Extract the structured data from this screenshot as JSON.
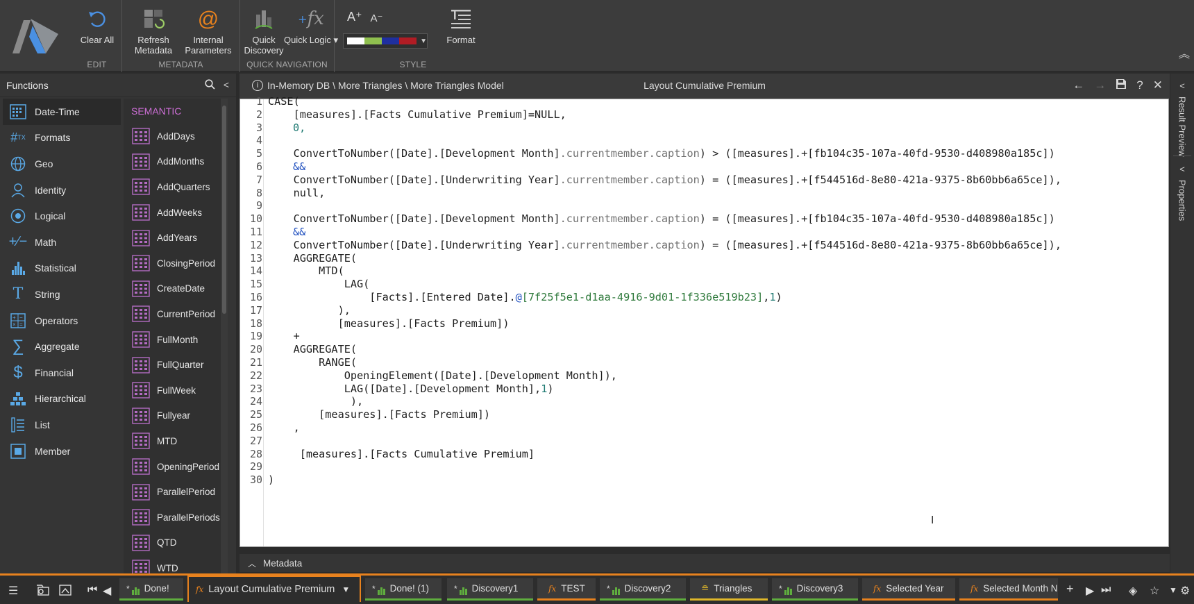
{
  "ribbon": {
    "groups": [
      {
        "label": "EDIT",
        "buttons": [
          {
            "label": "Clear All",
            "icon": "undo-icon"
          }
        ]
      },
      {
        "label": "METADATA",
        "buttons": [
          {
            "label": "Refresh Metadata",
            "icon": "refresh-metadata-icon"
          },
          {
            "label": "Internal Parameters",
            "icon": "at-sign-icon"
          }
        ]
      },
      {
        "label": "QUICK NAVIGATION",
        "buttons": [
          {
            "label": "Quick Discovery",
            "icon": "bar-chart-icon"
          },
          {
            "label": "Quick Logic ▾",
            "icon": "fx-icon"
          }
        ]
      },
      {
        "label": "STYLE",
        "buttons": [
          {
            "label": "Format",
            "icon": "format-icon"
          }
        ]
      }
    ],
    "font_size_icons": [
      "A⁺",
      "A⁻"
    ],
    "palette_colors": [
      "#ffffff",
      "#8fbf4f",
      "#1f2f9f",
      "#b01c24"
    ]
  },
  "functions_panel": {
    "title": "Functions",
    "categories": [
      "Date-Time",
      "Formats",
      "Geo",
      "Identity",
      "Logical",
      "Math",
      "Statistical",
      "String",
      "Operators",
      "Aggregate",
      "Financial",
      "Hierarchical",
      "List",
      "Member"
    ],
    "active_category": "Date-Time",
    "section_label": "SEMANTIC",
    "functions": [
      "AddDays",
      "AddMonths",
      "AddQuarters",
      "AddWeeks",
      "AddYears",
      "ClosingPeriod",
      "CreateDate",
      "CurrentPeriod",
      "FullMonth",
      "FullQuarter",
      "FullWeek",
      "Fullyear",
      "MTD",
      "OpeningPeriod",
      "ParallelPeriod",
      "ParallelPeriods",
      "QTD",
      "WTD"
    ]
  },
  "editor": {
    "path": "In-Memory DB \\ More Triangles \\ More Triangles Model",
    "title": "Layout Cumulative Premium",
    "line_numbers": [
      "1",
      "2",
      "3",
      "4",
      "5",
      "6",
      "7",
      "8",
      "9",
      "10",
      "11",
      "12",
      "13",
      "14",
      "15",
      "16",
      "17",
      "18",
      "19",
      "20",
      "21",
      "22",
      "23",
      "24",
      "25",
      "26",
      "27",
      "28",
      "29",
      "30"
    ],
    "code": {
      "l1": "CASE(",
      "l2": "    [measures].[Facts Cumulative Premium]=NULL,",
      "l3": "0,",
      "l5a": "    ConvertToNumber([Date].[Development Month]",
      "l5b": ".currentmember.caption",
      "l5c": ") > ([measures].+[fb104c35-107a-40fd-9530-d408980a185c])",
      "l6": "&&",
      "l7a": "    ConvertToNumber([Date].[Underwriting Year]",
      "l7b": ".currentmember.caption",
      "l7c": ") = ([measures].+[f544516d-8e80-421a-9375-8b60bb6a65ce]),",
      "l8": "    null,",
      "l10a": "    ConvertToNumber([Date].[Development Month]",
      "l10b": ".currentmember.caption",
      "l10c": ") = ([measures].+[fb104c35-107a-40fd-9530-d408980a185c])",
      "l11": "&&",
      "l12a": "    ConvertToNumber([Date].[Underwriting Year]",
      "l12b": ".currentmember.caption",
      "l12c": ") = ([measures].+[f544516d-8e80-421a-9375-8b60bb6a65ce]),",
      "l13": "    AGGREGATE(",
      "l14": "        MTD(",
      "l15": "            LAG(",
      "l16a": "                [Facts].[Entered Date].",
      "l16b": "@",
      "l16c": "[7f25f5e1-d1aa-4916-9d01-1f336e519b23]",
      "l16d": ",",
      "l16e": "1",
      "l16f": ")",
      "l17": "           ),",
      "l18": "           [measures].[Facts Premium])",
      "l19": "    +",
      "l20": "    AGGREGATE(",
      "l21": "        RANGE(",
      "l22": "            OpeningElement([Date].[Development Month]),",
      "l23a": "            LAG([Date].[Development Month],",
      "l23b": "1",
      "l23c": ")",
      "l24": "             ),",
      "l25": "        [measures].[Facts Premium])",
      "l26": "    ,",
      "l28": "     [measures].[Facts Cumulative Premium]",
      "l30": ")"
    }
  },
  "metadata_bar": {
    "label": "Metadata"
  },
  "right_panels": [
    "Result Preview",
    "Properties"
  ],
  "tabs": [
    {
      "label": "Done!",
      "modified": true,
      "type": "discovery"
    },
    {
      "label": "Layout Cumulative Premium",
      "modified": false,
      "type": "formula",
      "active": true
    },
    {
      "label": "Done! (1)",
      "modified": true,
      "type": "discovery"
    },
    {
      "label": "Discovery1",
      "modified": true,
      "type": "discovery"
    },
    {
      "label": "TEST",
      "modified": false,
      "type": "formula"
    },
    {
      "label": "Discovery2",
      "modified": true,
      "type": "discovery"
    },
    {
      "label": "Triangles",
      "modified": false,
      "type": "model"
    },
    {
      "label": "Discovery3",
      "modified": true,
      "type": "discovery"
    },
    {
      "label": "Selected Year",
      "modified": false,
      "type": "formula"
    },
    {
      "label": "Selected Month Nu",
      "modified": false,
      "type": "formula"
    }
  ],
  "colors": {
    "accent_orange": "#e8821e",
    "discovery_green": "#5fae3e",
    "model_yellow": "#e0b82a",
    "semantic_purple": "#cf6fd8",
    "icon_blue": "#5aa9e6"
  }
}
